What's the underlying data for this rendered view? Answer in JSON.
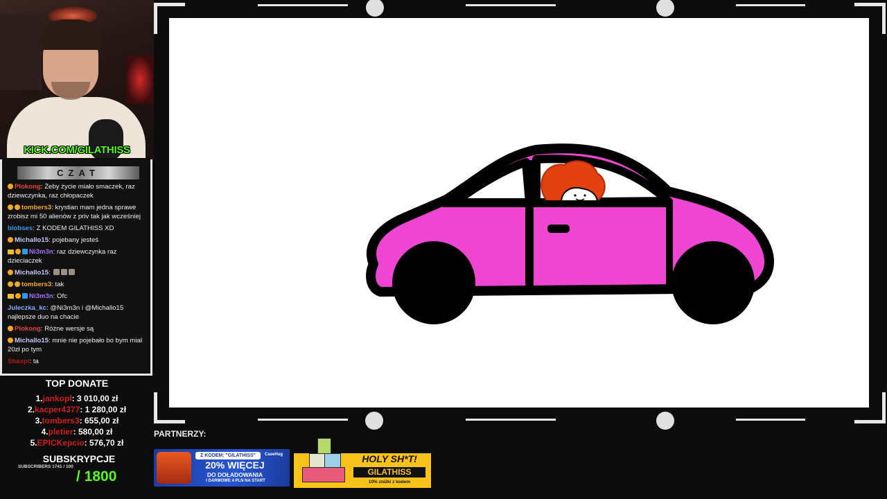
{
  "stream": {
    "kick_url": "KICK.COM/GILATHISS"
  },
  "chat": {
    "title": "CZAT",
    "messages": [
      {
        "user": "Plokong",
        "user_color": "#e84040",
        "badges": [
          "b-orange"
        ],
        "text": "Żeby życie miało smaczek, raz dziewczynka, raz chłopaczek"
      },
      {
        "user": "tombers3",
        "user_color": "#f5a623",
        "badges": [
          "b-gold",
          "b-orange"
        ],
        "text": "krystian mam jedna sprawe zrobisz mi 50 alienów z priv tak jak wcześniej"
      },
      {
        "user": "blobses",
        "user_color": "#2b9be8",
        "badges": [],
        "text": "Z KODEM GILATHISS XD"
      },
      {
        "user": "Michallo15",
        "user_color": "#c8c8ff",
        "badges": [
          "b-orange"
        ],
        "text": "pojebany jesteś"
      },
      {
        "user": "Ni3m3n",
        "user_color": "#a070ff",
        "badges": [
          "b-crown",
          "b-orange",
          "b-blue"
        ],
        "text": "raz dziewczynka raz dzieciaczek"
      },
      {
        "user": "Michallo15",
        "user_color": "#c8c8ff",
        "badges": [
          "b-orange"
        ],
        "text": ""
      },
      {
        "user": "tombers3",
        "user_color": "#f5a623",
        "badges": [
          "b-gold",
          "b-orange"
        ],
        "text": "tak"
      },
      {
        "user": "Ni3m3n",
        "user_color": "#a070ff",
        "badges": [
          "b-crown",
          "b-orange",
          "b-blue"
        ],
        "text": "Ofc"
      },
      {
        "user": "Juleczka_kc",
        "user_color": "#7fa8ff",
        "badges": [],
        "text": "@Ni3m3n i @Michallo15 najlepsze duo na chacie"
      },
      {
        "user": "Plokong",
        "user_color": "#e84040",
        "badges": [
          "b-orange"
        ],
        "text": "Różne wersje są"
      },
      {
        "user": "Michallo15",
        "user_color": "#c8c8ff",
        "badges": [
          "b-orange"
        ],
        "text": "mnie nie pojebało bo bym miał 20zł po tym"
      },
      {
        "user": "Shaxpi",
        "user_color": "#b01818",
        "badges": [],
        "text": "ta"
      }
    ]
  },
  "top_donate": {
    "title": "TOP DONATE",
    "entries": [
      {
        "rank": "1.",
        "name": "jankopl",
        "amount": ": 3 010,00 zł"
      },
      {
        "rank": "2.",
        "name": "kacper4377",
        "amount": ": 1 280,00 zł"
      },
      {
        "rank": "3.",
        "name": "tombers3",
        "amount": ": 655,00 zł"
      },
      {
        "rank": "4.",
        "name": "pletier",
        "amount": ": 580,00 zł"
      },
      {
        "rank": "5.",
        "name": "EPICKepcio",
        "amount": ": 576,70 zł"
      }
    ]
  },
  "subs": {
    "title": "SUBSKRYPCJE",
    "small": "SUBSCRIBERS 1741 / 100",
    "goal": "/ 1800"
  },
  "partners": {
    "label": "PARTNERZY:",
    "case_ad": {
      "code": "Z KODEM: \"GILATHISS\"",
      "brand": "CaseHug",
      "headline": "20% WIĘCEJ",
      "line2": "DO DOŁADOWANIA",
      "line3": "I DARMOWE 4 PLN NA START"
    },
    "holy_ad": {
      "headline": "HOLY SH*T!",
      "code": "GILATHISS",
      "small": "10% zniżki z kodem"
    }
  },
  "colors": {
    "kick_green": "#53fc18",
    "car_pink": "#ef45d2",
    "hair_orange": "#e3410f",
    "donor_red": "#d41f1f"
  }
}
